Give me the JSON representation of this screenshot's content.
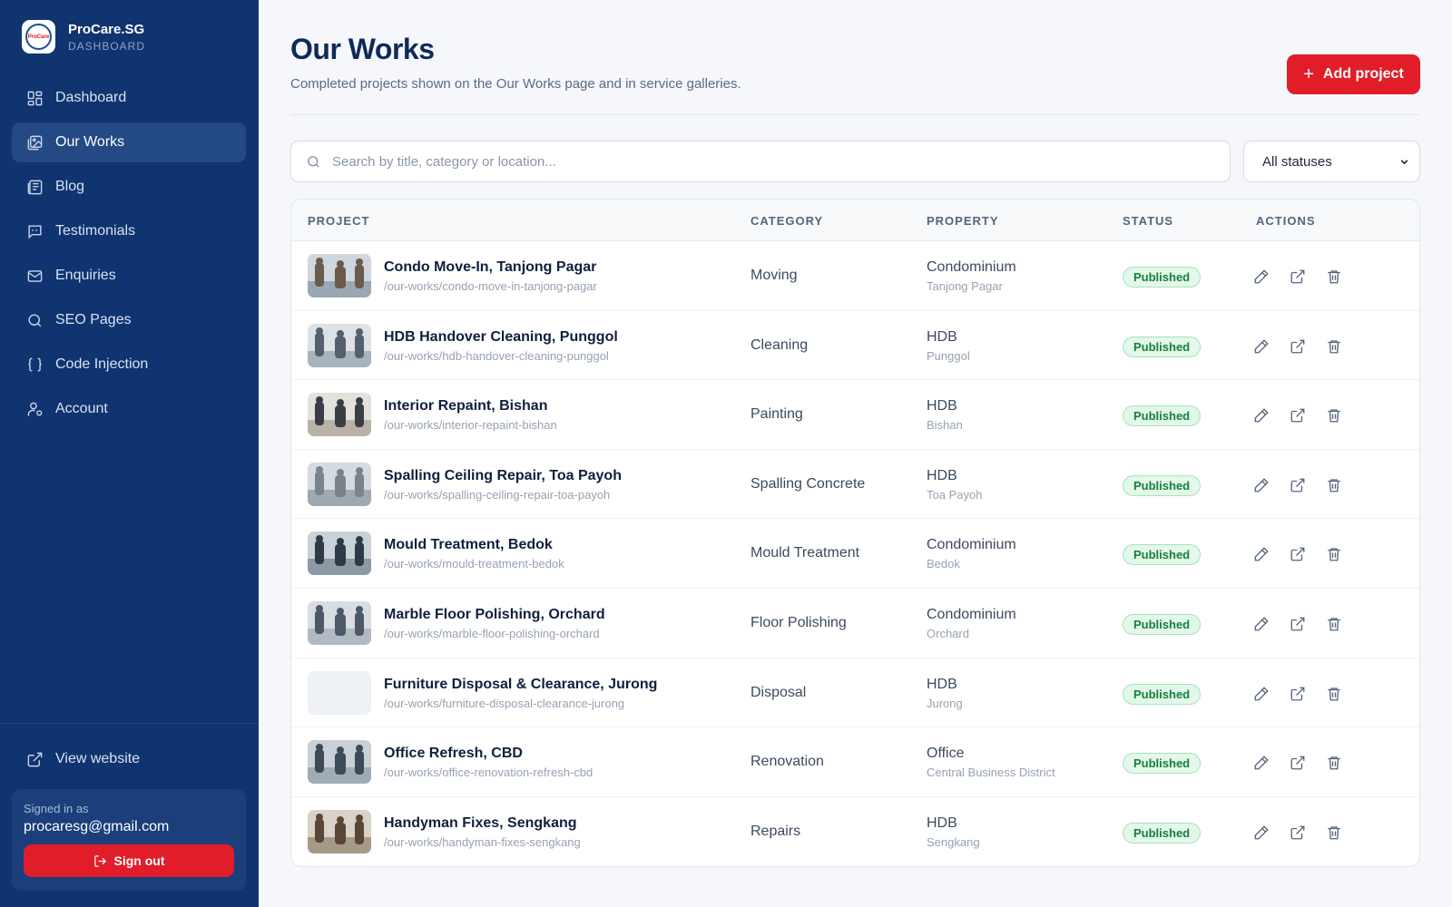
{
  "brand": {
    "name": "ProCare.SG",
    "sub": "DASHBOARD",
    "logo_text": "ProCare"
  },
  "nav": [
    {
      "label": "Dashboard",
      "icon": "grid-icon",
      "active": false
    },
    {
      "label": "Our Works",
      "icon": "image-icon",
      "active": true
    },
    {
      "label": "Blog",
      "icon": "newspaper-icon",
      "active": false
    },
    {
      "label": "Testimonials",
      "icon": "chat-icon",
      "active": false
    },
    {
      "label": "Enquiries",
      "icon": "mail-icon",
      "active": false
    },
    {
      "label": "SEO Pages",
      "icon": "search-icon",
      "active": false
    },
    {
      "label": "Code Injection",
      "icon": "braces-icon",
      "active": false
    },
    {
      "label": "Account",
      "icon": "user-settings-icon",
      "active": false
    }
  ],
  "sidebar_footer": {
    "view_website": "View website",
    "signed_label": "Signed in as",
    "email": "procaresg@gmail.com",
    "signout": "Sign out"
  },
  "header": {
    "title": "Our Works",
    "subtitle": "Completed projects shown on the Our Works page and in service galleries.",
    "add_button": "Add project"
  },
  "filters": {
    "search_placeholder": "Search by title, category or location...",
    "status_value": "All statuses"
  },
  "table": {
    "columns": {
      "project": "PROJECT",
      "category": "CATEGORY",
      "property": "PROPERTY",
      "status": "STATUS",
      "actions": "ACTIONS"
    },
    "rows": [
      {
        "title": "Condo Move-In, Tanjong Pagar",
        "path": "/our-works/condo-move-in-tanjong-pagar",
        "category": "Moving",
        "property": "Condominium",
        "location": "Tanjong Pagar",
        "status": "Published",
        "thumb": true
      },
      {
        "title": "HDB Handover Cleaning, Punggol",
        "path": "/our-works/hdb-handover-cleaning-punggol",
        "category": "Cleaning",
        "property": "HDB",
        "location": "Punggol",
        "status": "Published",
        "thumb": true
      },
      {
        "title": "Interior Repaint, Bishan",
        "path": "/our-works/interior-repaint-bishan",
        "category": "Painting",
        "property": "HDB",
        "location": "Bishan",
        "status": "Published",
        "thumb": true
      },
      {
        "title": "Spalling Ceiling Repair, Toa Payoh",
        "path": "/our-works/spalling-ceiling-repair-toa-payoh",
        "category": "Spalling Concrete",
        "property": "HDB",
        "location": "Toa Payoh",
        "status": "Published",
        "thumb": true
      },
      {
        "title": "Mould Treatment, Bedok",
        "path": "/our-works/mould-treatment-bedok",
        "category": "Mould Treatment",
        "property": "Condominium",
        "location": "Bedok",
        "status": "Published",
        "thumb": true
      },
      {
        "title": "Marble Floor Polishing, Orchard",
        "path": "/our-works/marble-floor-polishing-orchard",
        "category": "Floor Polishing",
        "property": "Condominium",
        "location": "Orchard",
        "status": "Published",
        "thumb": true
      },
      {
        "title": "Furniture Disposal & Clearance, Jurong",
        "path": "/our-works/furniture-disposal-clearance-jurong",
        "category": "Disposal",
        "property": "HDB",
        "location": "Jurong",
        "status": "Published",
        "thumb": false
      },
      {
        "title": "Office Refresh, CBD",
        "path": "/our-works/office-renovation-refresh-cbd",
        "category": "Renovation",
        "property": "Office",
        "location": "Central Business District",
        "status": "Published",
        "thumb": true
      },
      {
        "title": "Handyman Fixes, Sengkang",
        "path": "/our-works/handyman-fixes-sengkang",
        "category": "Repairs",
        "property": "HDB",
        "location": "Sengkang",
        "status": "Published",
        "thumb": true
      }
    ]
  },
  "colors": {
    "sidebar": "#0f3470",
    "accent": "#e11d2a",
    "badge_green": "#15803d"
  }
}
